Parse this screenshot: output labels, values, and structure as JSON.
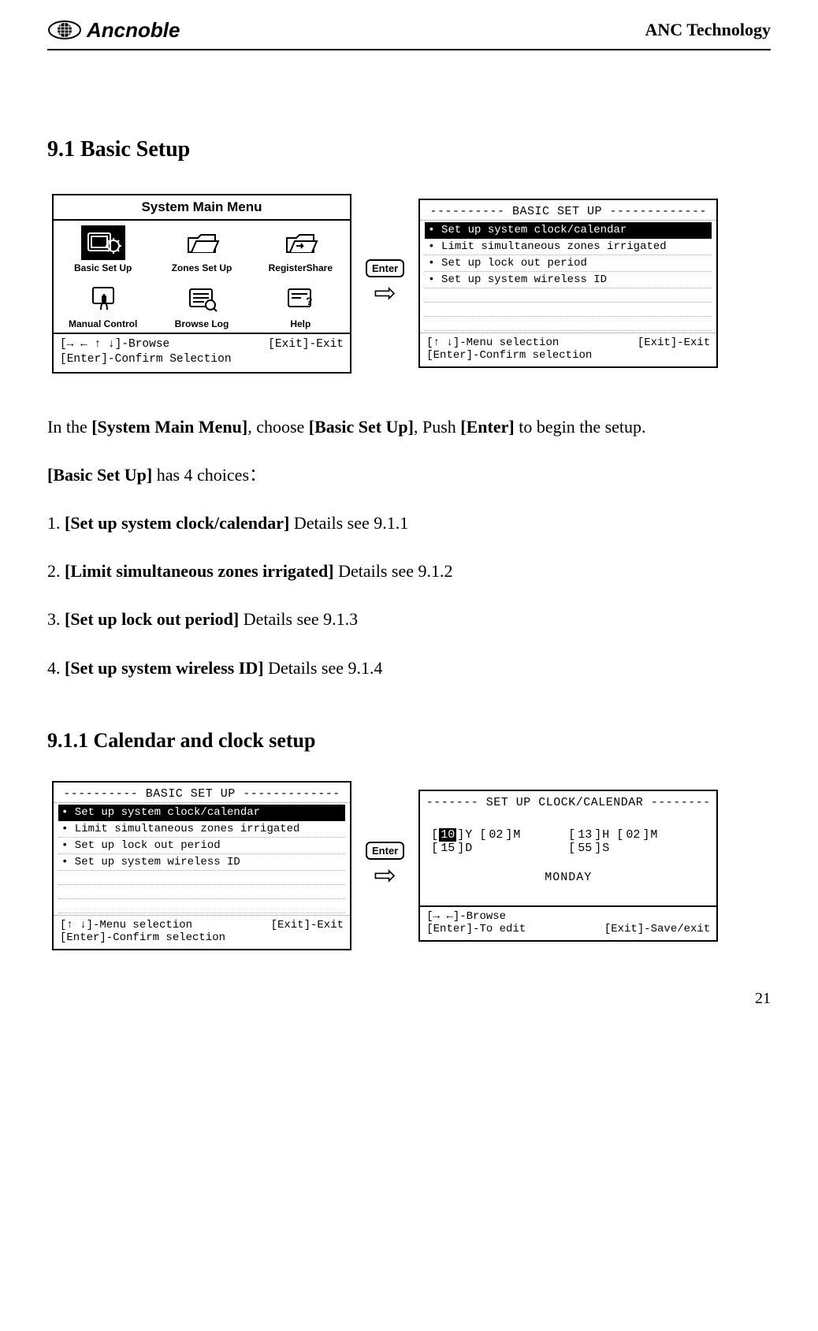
{
  "header": {
    "logo_text": "Ancnoble",
    "company": "ANC Technology"
  },
  "section_9_1": "9.1 Basic Setup",
  "main_menu": {
    "title": "System Main Menu",
    "items": [
      {
        "label": "Basic Set Up"
      },
      {
        "label": "Zones Set Up"
      },
      {
        "label": "RegisterShare"
      },
      {
        "label": "Manual Control"
      },
      {
        "label": "Browse Log"
      },
      {
        "label": "Help"
      }
    ],
    "hint_browse": "[→ ← ↑ ↓]-Browse",
    "hint_exit": "[Exit]-Exit",
    "hint_confirm": "[Enter]-Confirm Selection"
  },
  "enter_label": "Enter",
  "basic_setup": {
    "title": "----------  BASIC SET UP  -------------",
    "items": [
      "• Set up system clock/calendar",
      "• Limit simultaneous zones irrigated",
      "• Set up lock out period",
      "• Set up system wireless ID"
    ],
    "hint_menu": "[↑ ↓]-Menu selection",
    "hint_exit": "[Exit]-Exit",
    "hint_confirm": "[Enter]-Confirm selection"
  },
  "paragraphs": {
    "p1_a": "In the ",
    "p1_b": "[System Main Menu]",
    "p1_c": ", choose ",
    "p1_d": "[Basic Set Up]",
    "p1_e": ", Push ",
    "p1_f": "[Enter]",
    "p1_g": " to begin the setup.",
    "p2_a": "[Basic Set Up]",
    "p2_b": " has 4 choices：",
    "li1_a": "1. ",
    "li1_b": "[Set up system clock/calendar]",
    "li1_c": " Details see 9.1.1",
    "li2_a": "2. ",
    "li2_b": "[Limit simultaneous zones irrigated]",
    "li2_c": " Details see 9.1.2",
    "li3_a": "3. ",
    "li3_b": "[Set up lock out period]",
    "li3_c": " Details see 9.1.3",
    "li4_a": "4. ",
    "li4_b": "[Set up system wireless ID]",
    "li4_c": " Details see 9.1.4"
  },
  "section_9_1_1": "9.1.1 Calendar and clock setup",
  "clock_screen": {
    "title": "-------  SET UP CLOCK/CALENDAR  --------",
    "y": "10",
    "m": "02",
    "d": "15",
    "h": "13",
    "min": "02",
    "s": "55",
    "ylab": "Y",
    "mlab": "M",
    "dlab": "D",
    "hlab": "H",
    "minlab": "M",
    "slab": "S",
    "lbY": "[",
    "rbY": "]",
    "lb": "[",
    "rb": "]",
    "day": "MONDAY",
    "hint_browse": "[→ ←]-Browse",
    "hint_edit": "[Enter]-To edit",
    "hint_exit": "[Exit]-Save/exit"
  },
  "page_number": "21"
}
